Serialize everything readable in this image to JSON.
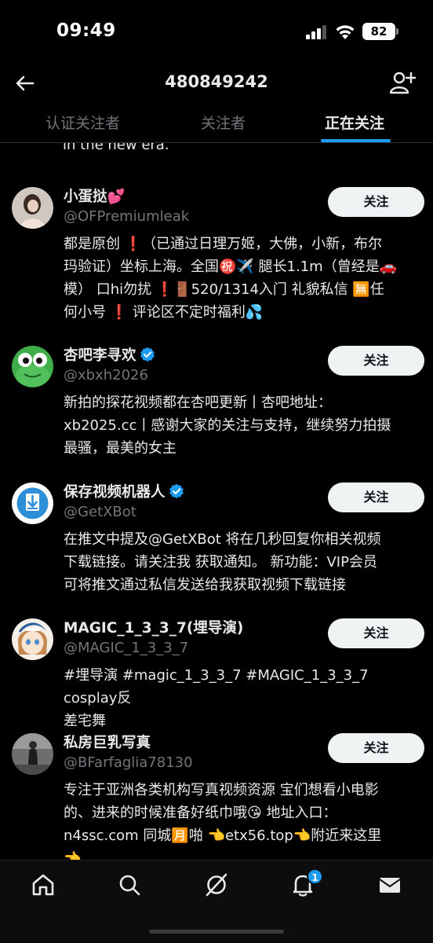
{
  "status_bar": {
    "time": "09:49",
    "battery": "82"
  },
  "header": {
    "title": "480849242"
  },
  "tabs": [
    {
      "label": "认证关注者"
    },
    {
      "label": "关注者"
    },
    {
      "label": "正在关注"
    }
  ],
  "active_tab": "正在关注",
  "list": {
    "clipped_text": "in the new era.",
    "follow_label": "关注",
    "users": [
      {
        "name": "小蛋挞💕",
        "handle": "@OFPremiumleak",
        "verified": false,
        "bio_lines": [
          "都是原创 ❗（已通过日理万姬，大佛，小新，布尔",
          "玛验证）坐标上海。全国㊗️✈️ 腿长1.1m（曾经是🚗",
          "模） 口hi勿扰 ❗🚪520/1314入门 礼貌私信 🈚任",
          "何小号 ❗ 评论区不定时福利💦"
        ]
      },
      {
        "name": "杏吧李寻欢",
        "handle": "@xbxh2026",
        "verified": true,
        "bio_lines": [
          "新拍的探花视频都在杏吧更新丨杏吧地址：",
          "xb2025.cc丨感谢大家的关注与支持，继续努力拍摄",
          "最骚，最美的女主"
        ]
      },
      {
        "name": "保存视频机器人",
        "handle": "@GetXBot",
        "verified": true,
        "bio_lines": [
          "在推文中提及@GetXBot 将在几秒回复你相关视频",
          "下载链接。请关注我 获取通知。 新功能：VIP会员",
          "可将推文通过私信发送给我获取视频下载链接"
        ]
      },
      {
        "name": "MAGIC_1_3_3_7(埋导演)",
        "handle": "@MAGIC_1_3_3_7",
        "verified": false,
        "bio_lines": [
          "#埋导演 #magic_1_3_3_7 #MAGIC_1_3_3_7 cosplay反",
          "差宅舞"
        ]
      },
      {
        "name": "私房巨乳写真",
        "handle": "@BFarfaglia78130",
        "verified": false,
        "bio_lines": [
          "专注于亚洲各类机构写真视频资源 宝们想看小电影",
          "的、进来的时候准备好纸巾哦😘 地址入口：",
          "n4ssc.com 同城🈷️啪 👈etx56.top👈附近来这里",
          "👈"
        ]
      }
    ]
  },
  "bottom_nav": {
    "items": [
      "home-icon",
      "search-icon",
      "grok-icon",
      "notifications-icon",
      "messages-icon"
    ],
    "notification_badge": "1"
  },
  "colors": {
    "accent": "#1d9bf0",
    "background": "#000000",
    "muted": "#71767b"
  }
}
